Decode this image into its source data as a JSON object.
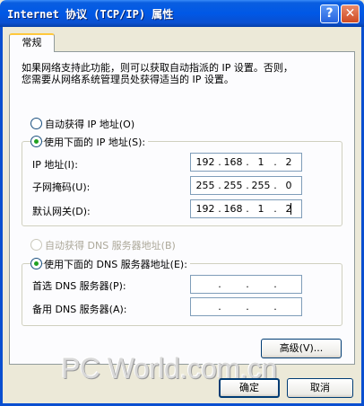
{
  "window": {
    "title": "Internet 协议 (TCP/IP) 属性",
    "help_glyph": "?",
    "close_glyph": "✕"
  },
  "tab": {
    "label": "常规"
  },
  "description": {
    "line1": "如果网络支持此功能，则可以获取自动指派的 IP 设置。否则，",
    "line2": "您需要从网络系统管理员处获得适当的 IP 设置。"
  },
  "ip_section": {
    "auto_label": "自动获得 IP 地址(O)",
    "manual_label": "使用下面的 IP 地址(S):",
    "ip_label": "IP 地址(I):",
    "mask_label": "子网掩码(U):",
    "gateway_label": "默认网关(D):",
    "ip": [
      "192",
      "168",
      "1",
      "2"
    ],
    "mask": [
      "255",
      "255",
      "255",
      "0"
    ],
    "gateway": [
      "192",
      "168",
      "1",
      "2"
    ]
  },
  "dns_section": {
    "auto_label": "自动获得 DNS 服务器地址(B)",
    "manual_label": "使用下面的 DNS 服务器地址(E):",
    "preferred_label": "首选 DNS 服务器(P):",
    "alternate_label": "备用 DNS 服务器(A):"
  },
  "buttons": {
    "advanced": "高级(V)...",
    "ok": "确定",
    "cancel": "取消"
  },
  "watermark": "PC World.com.cn",
  "colors": {
    "title_bar": "#0058e6",
    "face": "#ece9d8",
    "radio_dot": "#21a121"
  }
}
